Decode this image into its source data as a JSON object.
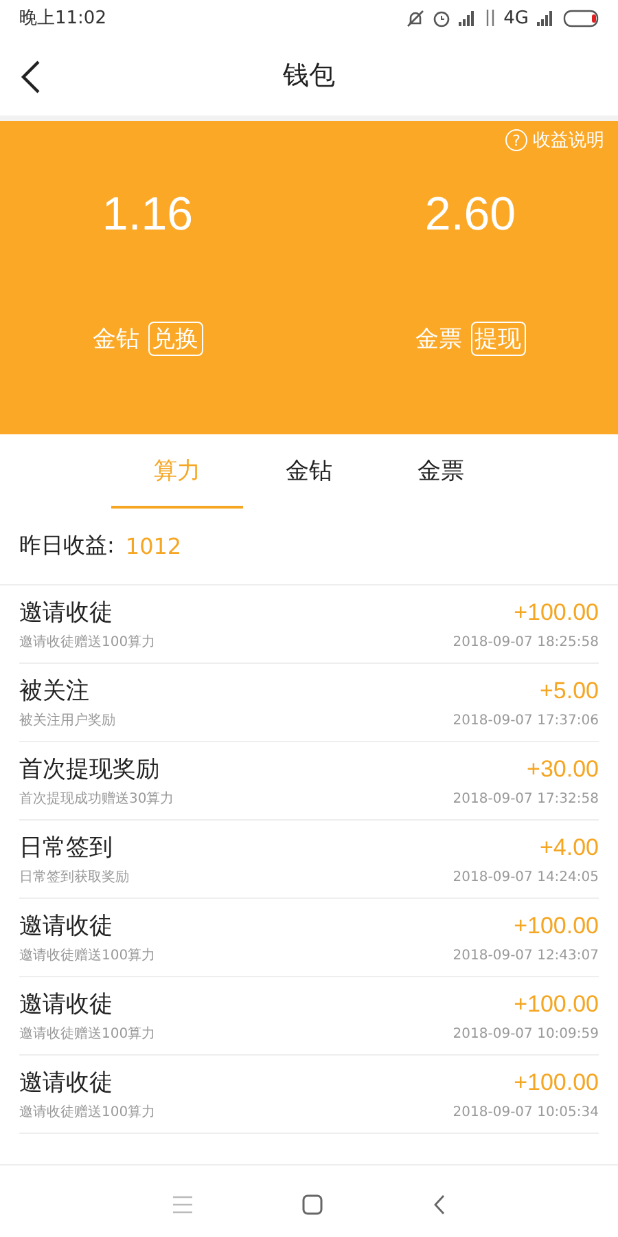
{
  "status_bar": {
    "time": "晚上11:02",
    "network": "4G"
  },
  "header": {
    "title": "钱包"
  },
  "help": {
    "icon": "?",
    "label": "收益说明"
  },
  "balances": [
    {
      "value": "1.16",
      "label": "金钻",
      "action": "兑换"
    },
    {
      "value": "2.60",
      "label": "金票",
      "action": "提现"
    }
  ],
  "tabs": [
    {
      "label": "算力",
      "selected": true
    },
    {
      "label": "金钻",
      "selected": false
    },
    {
      "label": "金票",
      "selected": false
    }
  ],
  "yesterday": {
    "label": "昨日收益:",
    "value": "1012"
  },
  "records": [
    {
      "title": "邀请收徒",
      "subtitle": "邀请收徒赠送100算力",
      "amount": "+100.00",
      "time": "2018-09-07 18:25:58"
    },
    {
      "title": "被关注",
      "subtitle": "被关注用户奖励",
      "amount": "+5.00",
      "time": "2018-09-07 17:37:06"
    },
    {
      "title": "首次提现奖励",
      "subtitle": "首次提现成功赠送30算力",
      "amount": "+30.00",
      "time": "2018-09-07 17:32:58"
    },
    {
      "title": "日常签到",
      "subtitle": "日常签到获取奖励",
      "amount": "+4.00",
      "time": "2018-09-07 14:24:05"
    },
    {
      "title": "邀请收徒",
      "subtitle": "邀请收徒赠送100算力",
      "amount": "+100.00",
      "time": "2018-09-07 12:43:07"
    },
    {
      "title": "邀请收徒",
      "subtitle": "邀请收徒赠送100算力",
      "amount": "+100.00",
      "time": "2018-09-07 10:09:59"
    },
    {
      "title": "邀请收徒",
      "subtitle": "邀请收徒赠送100算力",
      "amount": "+100.00",
      "time": "2018-09-07 10:05:34"
    }
  ]
}
